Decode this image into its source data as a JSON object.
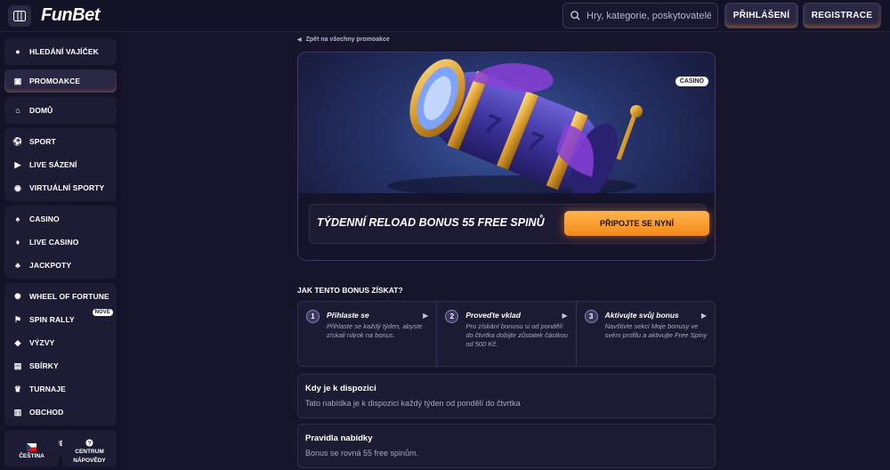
{
  "header": {
    "logo": "FunBet",
    "search_placeholder": "Hry, kategorie, poskytovatelé",
    "login_label": "PŘIHLÁŠENÍ",
    "register_label": "REGISTRACE"
  },
  "sidebar": {
    "groups": [
      [
        {
          "label": "HLEDÁNÍ VAJÍČEK",
          "icon": "egg-icon"
        }
      ],
      [
        {
          "label": "PROMOAKCE",
          "icon": "gift-icon",
          "active": true
        }
      ],
      [
        {
          "label": "DOMŮ",
          "icon": "home-icon"
        }
      ],
      [
        {
          "label": "SPORT",
          "icon": "soccer-ball-icon"
        },
        {
          "label": "LIVE SÁZENÍ",
          "icon": "live-play-icon"
        },
        {
          "label": "VIRTUÁLNÍ SPORTY",
          "icon": "gamepad-icon"
        }
      ],
      [
        {
          "label": "CASINO",
          "icon": "cards-icon"
        },
        {
          "label": "LIVE CASINO",
          "icon": "live-cards-icon"
        },
        {
          "label": "JACKPOTY",
          "icon": "clover-icon"
        }
      ],
      [
        {
          "label": "WHEEL OF FORTUNE",
          "icon": "wheel-icon"
        },
        {
          "label": "SPIN RALLY",
          "icon": "flag-icon",
          "badge": "NOVÉ"
        },
        {
          "label": "VÝZVY",
          "icon": "challenge-icon"
        },
        {
          "label": "SBÍRKY",
          "icon": "collection-icon"
        },
        {
          "label": "TURNAJE",
          "icon": "trophy-icon"
        },
        {
          "label": "OBCHOD",
          "icon": "shop-icon"
        }
      ],
      [
        {
          "label": "VIP KLUB",
          "icon": "crown-icon"
        }
      ]
    ],
    "language_label": "ČEŠTINA",
    "help_label_1": "CENTRUM",
    "help_label_2": "NÁPOVĚDY"
  },
  "main": {
    "back_label": "Zpět na všechny promoakce",
    "casino_badge": "CASINO",
    "promo_title": "TÝDENNÍ RELOAD BONUS 55 FREE SPINŮ",
    "cta_label": "PŘIPOJTE SE NYNÍ",
    "how_title": "JAK TENTO BONUS ZÍSKAT?",
    "steps": [
      {
        "num": "1",
        "title": "Přihlaste se",
        "text": "Přihlaste se každý týden, abyste získali nárok na bonus."
      },
      {
        "num": "2",
        "title": "Proveďte vklad",
        "text": "Pro získání bonusu si od pondělí do čtvrtka dobijte zůstatek částkou od 500 Kč."
      },
      {
        "num": "3",
        "title": "Aktivujte svůj bonus",
        "text": "Navštivte sekci Moje bonusy ve svém profilu a aktivujte Free Spiny"
      }
    ],
    "availability": {
      "title": "Kdy je k dispozici",
      "text": "Tato nabídka je k dispozici každý týden od pondělí do čtvrtka"
    },
    "rules": {
      "title": "Pravidla nabídky",
      "text": "Bonus se rovná 55 free spinům."
    }
  },
  "colors": {
    "accent": "#f28a1a",
    "background": "#17152b",
    "panel": "#1d1b33"
  }
}
